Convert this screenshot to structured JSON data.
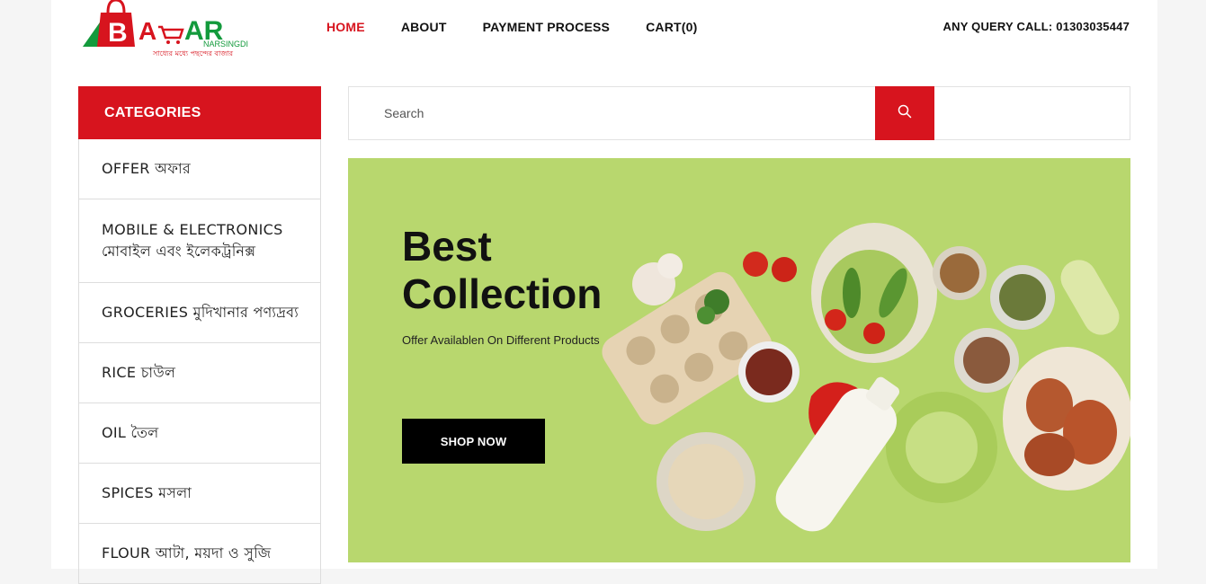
{
  "brand": {
    "logo_letters": "BAZAR",
    "logo_sub": "NARSINGDI",
    "logo_tagline": "সাধ্যের মধ্যে পছন্দের বাজার",
    "colors": {
      "red": "#d7141e",
      "green": "#139a3c"
    }
  },
  "nav": {
    "items": [
      {
        "label": "HOME",
        "active": true
      },
      {
        "label": "ABOUT"
      },
      {
        "label": "PAYMENT PROCESS"
      },
      {
        "label": "CART(0)"
      }
    ]
  },
  "query_text": "ANY QUERY CALL: 01303035447",
  "categories": {
    "title": "CATEGORIES",
    "items": [
      {
        "label": "OFFER অফার"
      },
      {
        "label": "MOBILE & ELECTRONICS\nমোবাইল এবং ইলেকট্রনিক্স"
      },
      {
        "label": "GROCERIES মুদিখানার পণ্যদ্রব্য"
      },
      {
        "label": "RICE চাউল"
      },
      {
        "label": "OIL তৈল"
      },
      {
        "label": "SPICES মসলা"
      },
      {
        "label": "FLOUR আটা, ময়দা ও সুজি"
      }
    ]
  },
  "search": {
    "placeholder": "Search",
    "value": "",
    "icon": "search-icon"
  },
  "banner": {
    "title": "Best Collection",
    "subtitle": "Offer Availablen On Different Products",
    "button": "SHOP NOW",
    "background": "#b8d76e"
  }
}
